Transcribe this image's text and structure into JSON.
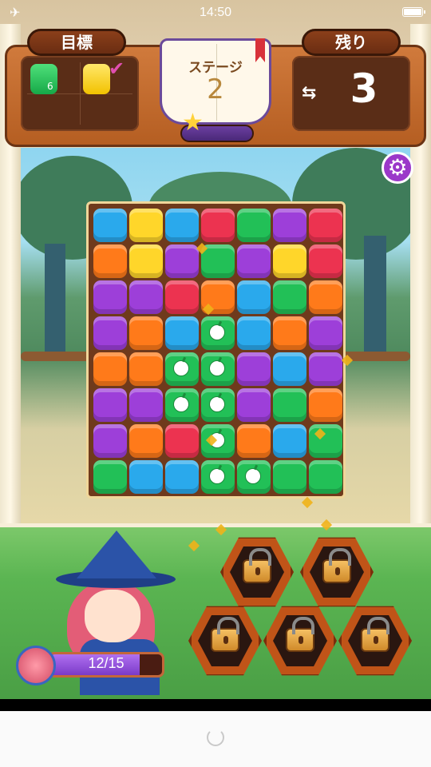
{
  "status_bar": {
    "time": "14:50"
  },
  "hud": {
    "goal_label": "目標",
    "moves_label": "残り",
    "moves_remaining": "3",
    "goals": [
      {
        "color": "green",
        "count": "6"
      },
      {
        "color": "yellow",
        "completed": true
      }
    ]
  },
  "stage": {
    "label": "ステージ",
    "number": "2"
  },
  "board": {
    "rows": [
      [
        "blue",
        "yellow",
        "blue",
        "red",
        "green",
        "purple",
        "red"
      ],
      [
        "orange",
        "yellow",
        "purple",
        "green",
        "purple",
        "yellow",
        "red"
      ],
      [
        "purple",
        "purple",
        "red",
        "orange",
        "blue",
        "green",
        "orange"
      ],
      [
        "purple",
        "orange",
        "blue",
        "bomb",
        "blue",
        "orange",
        "purple"
      ],
      [
        "orange",
        "orange",
        "bomb",
        "bomb",
        "purple",
        "blue",
        "purple"
      ],
      [
        "purple",
        "purple",
        "bomb",
        "bomb",
        "purple",
        "green",
        "orange"
      ],
      [
        "purple",
        "orange",
        "red",
        "bomb",
        "orange",
        "blue",
        "green"
      ],
      [
        "green",
        "blue",
        "blue",
        "bomb",
        "bomb",
        "green",
        "green"
      ]
    ]
  },
  "progress": {
    "label": "12/15",
    "current": 12,
    "max": 15
  },
  "boosters": [
    {
      "icon": "padlock-icon",
      "locked": true
    },
    {
      "icon": "padlock-icon",
      "locked": true
    },
    {
      "icon": "padlock-icon",
      "locked": true
    },
    {
      "icon": "padlock-icon",
      "locked": true
    },
    {
      "icon": "padlock-icon",
      "locked": true
    }
  ],
  "colors": {
    "blue": "#2aa9ec",
    "yellow": "#ffd62a",
    "red": "#ec3350",
    "green": "#22c057",
    "purple": "#9d3fd9",
    "orange": "#ff7a1a",
    "bomb": "#22c057"
  }
}
